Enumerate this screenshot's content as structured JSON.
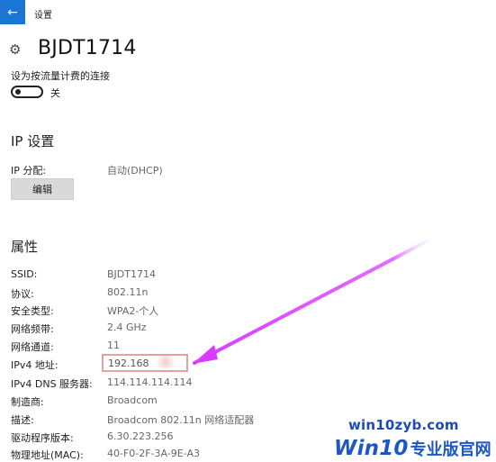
{
  "header": {
    "back_icon": "←",
    "title": "设置"
  },
  "network": {
    "gear_icon": "⚙",
    "name": "BJDT1714"
  },
  "metered": {
    "label": "设为按流量计费的连接",
    "state": "关"
  },
  "ip_settings": {
    "title": "IP 设置",
    "assignment_label": "IP 分配:",
    "assignment_value": "自动(DHCP)",
    "edit_label": "编辑"
  },
  "properties": {
    "title": "属性",
    "rows": [
      {
        "label": "SSID:",
        "value": "BJDT1714"
      },
      {
        "label": "协议:",
        "value": "802.11n"
      },
      {
        "label": "安全类型:",
        "value": "WPA2-个人"
      },
      {
        "label": "网络频带:",
        "value": "2.4 GHz"
      },
      {
        "label": "网络通道:",
        "value": "11"
      },
      {
        "label": "IPv4 地址:",
        "value": "192.168"
      },
      {
        "label": "IPv4 DNS 服务器:",
        "value": "114.114.114.114"
      },
      {
        "label": "制造商:",
        "value": "Broadcom"
      },
      {
        "label": "描述:",
        "value": "Broadcom 802.11n 网络适配器"
      },
      {
        "label": "驱动程序版本:",
        "value": "6.30.223.256"
      },
      {
        "label": "物理地址(MAC):",
        "value": "40-F0-2F-3A-9E-A3"
      }
    ]
  },
  "watermark": {
    "url": "win10zyb.com",
    "brand": "Win10",
    "subtitle": "专业版官网"
  },
  "colors": {
    "accent": "#1976d2",
    "annotation_arrow": "#d23cff",
    "ipv4_highlight": "#e6a0a0",
    "watermark_blue": "#1d56c5"
  }
}
